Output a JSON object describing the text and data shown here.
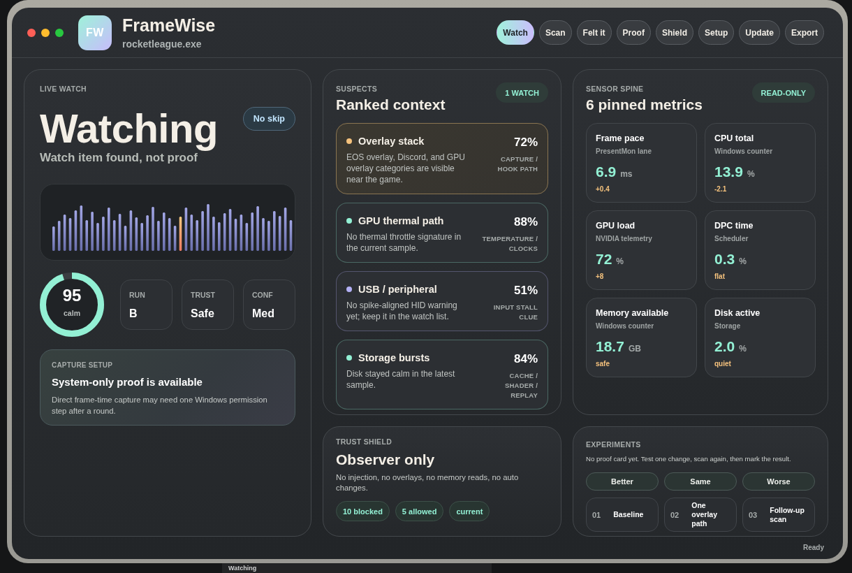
{
  "window": {
    "logo": "FW",
    "title": "FrameWise",
    "subtitle": "rocketleague.exe"
  },
  "nav": [
    {
      "label": "Watch",
      "selected": true
    },
    {
      "label": "Scan",
      "selected": false
    },
    {
      "label": "Felt it",
      "selected": false
    },
    {
      "label": "Proof",
      "selected": false
    },
    {
      "label": "Shield",
      "selected": false
    },
    {
      "label": "Setup",
      "selected": false
    },
    {
      "label": "Update",
      "selected": false
    },
    {
      "label": "Export",
      "selected": false
    }
  ],
  "live_watch": {
    "eyebrow": "LIVE WATCH",
    "status": "Watching",
    "badge": "No skip",
    "summary": "Watch item found, not proof",
    "score": {
      "value": "95",
      "caption": "calm",
      "level": 0.95
    },
    "stats": [
      {
        "label": "RUN",
        "value": "B"
      },
      {
        "label": "TRUST",
        "value": "Safe"
      },
      {
        "label": "CONF",
        "value": "Med"
      }
    ],
    "capture_setup": {
      "eyebrow": "CAPTURE SETUP",
      "title": "System-only proof is available",
      "body": "Direct frame-time capture may need one Windows permission step after a round."
    }
  },
  "suspects": {
    "eyebrow": "SUSPECTS",
    "title": "Ranked context",
    "badge": "1 WATCH",
    "items": [
      {
        "name": "Overlay stack",
        "description": "EOS overlay, Discord, and GPU overlay categories are visible near the game.",
        "score": "72%",
        "category": "CAPTURE / HOOK PATH",
        "color": "#f5c27d",
        "selected": true
      },
      {
        "name": "GPU thermal path",
        "description": "No thermal throttle signature in the current sample.",
        "score": "88%",
        "category": "TEMPERATURE / CLOCKS",
        "color": "#93f0d4",
        "selected": false
      },
      {
        "name": "USB / peripheral",
        "description": "No spike-aligned HID warning yet; keep it in the watch list.",
        "score": "51%",
        "category": "INPUT STALL CLUE",
        "color": "#b3b0f5",
        "selected": false
      },
      {
        "name": "Storage bursts",
        "description": "Disk stayed calm in the latest sample.",
        "score": "84%",
        "category": "CACHE / SHADER / REPLAY",
        "color": "#93f0d4",
        "selected": false
      }
    ]
  },
  "trust_shield": {
    "eyebrow": "TRUST SHIELD",
    "title": "Observer only",
    "body": "No injection, no overlays, no memory reads, no auto changes.",
    "chips": [
      "10 blocked",
      "5 allowed",
      "current"
    ]
  },
  "sensor_spine": {
    "eyebrow": "SENSOR SPINE",
    "title": "6 pinned metrics",
    "badge": "READ-ONLY",
    "metrics": [
      {
        "name": "Frame pace",
        "source": "PresentMon lane",
        "value": "6.9",
        "unit": "ms",
        "delta": "+0.4"
      },
      {
        "name": "CPU total",
        "source": "Windows counter",
        "value": "13.9",
        "unit": "%",
        "delta": "-2.1"
      },
      {
        "name": "GPU load",
        "source": "NVIDIA telemetry",
        "value": "72",
        "unit": "%",
        "delta": "+8"
      },
      {
        "name": "DPC time",
        "source": "Scheduler",
        "value": "0.3",
        "unit": "%",
        "delta": "flat"
      },
      {
        "name": "Memory available",
        "source": "Windows counter",
        "value": "18.7",
        "unit": "GB",
        "delta": "safe"
      },
      {
        "name": "Disk active",
        "source": "Storage",
        "value": "2.0",
        "unit": "%",
        "delta": "quiet"
      }
    ]
  },
  "experiments": {
    "eyebrow": "EXPERIMENTS",
    "hint": "No proof card yet. Test one change, scan again, then mark the result.",
    "verdicts": [
      "Better",
      "Same",
      "Worse"
    ],
    "steps": [
      {
        "number": "01",
        "label": "Baseline"
      },
      {
        "number": "02",
        "label": "One overlay path"
      },
      {
        "number": "03",
        "label": "Follow-up scan"
      }
    ]
  },
  "status_bar": {
    "text": "Ready"
  },
  "background": {
    "window_title": "Watching"
  }
}
